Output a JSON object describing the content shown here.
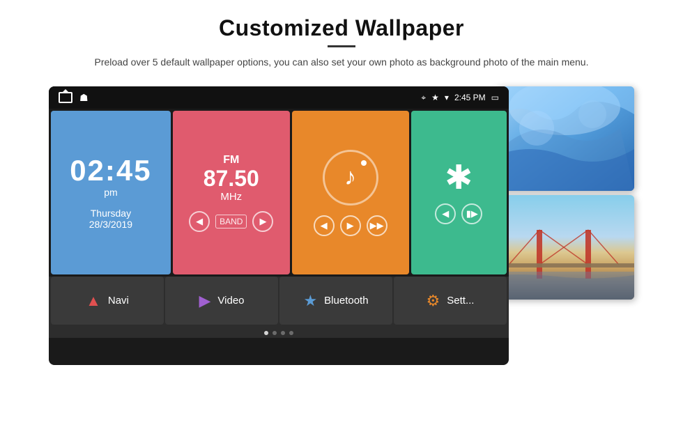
{
  "header": {
    "title": "Customized Wallpaper",
    "subtitle": "Preload over 5 default wallpaper options, you can also set your own photo as background photo of the main menu."
  },
  "statusBar": {
    "time": "2:45 PM",
    "batteryIcon": "🔋"
  },
  "clockWidget": {
    "time": "02:45",
    "ampm": "pm",
    "day": "Thursday",
    "date": "28/3/2019"
  },
  "fmWidget": {
    "label": "FM",
    "frequency": "87.50",
    "unit": "MHz"
  },
  "bottomNav": {
    "items": [
      {
        "label": "Navi",
        "icon": "navi"
      },
      {
        "label": "Video",
        "icon": "video"
      },
      {
        "label": "Bluetooth",
        "icon": "bt"
      },
      {
        "label": "Sett...",
        "icon": "settings"
      }
    ]
  },
  "dots": [
    true,
    false,
    false,
    false
  ]
}
